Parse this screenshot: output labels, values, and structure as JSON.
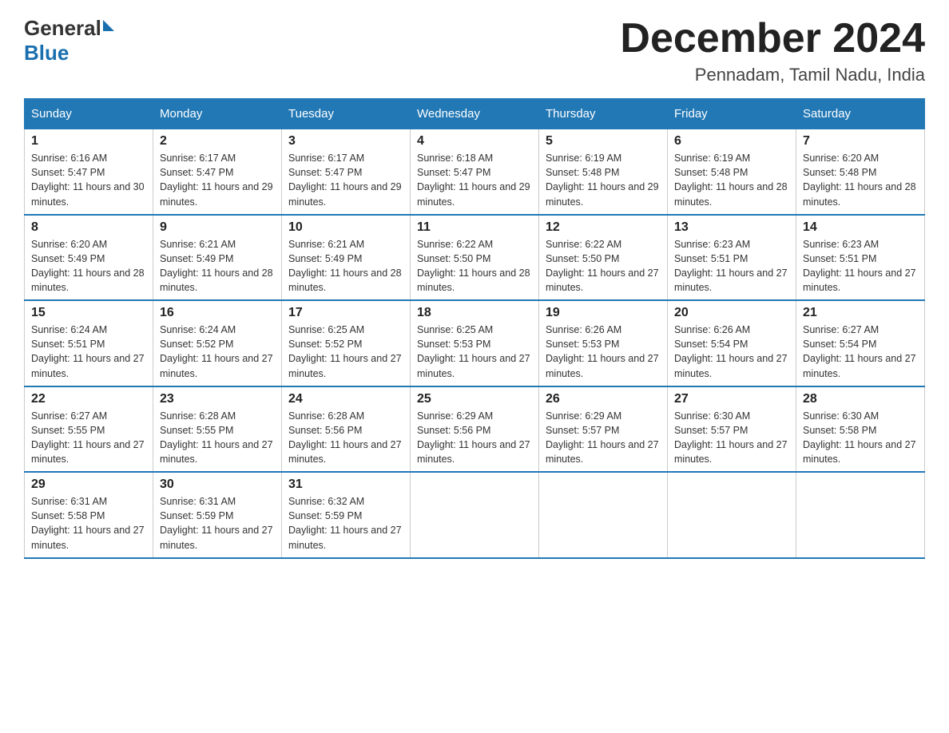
{
  "header": {
    "logo_general": "General",
    "logo_blue": "Blue",
    "month_title": "December 2024",
    "location": "Pennadam, Tamil Nadu, India"
  },
  "weekdays": [
    "Sunday",
    "Monday",
    "Tuesday",
    "Wednesday",
    "Thursday",
    "Friday",
    "Saturday"
  ],
  "weeks": [
    [
      {
        "day": "1",
        "sunrise": "6:16 AM",
        "sunset": "5:47 PM",
        "daylight": "11 hours and 30 minutes."
      },
      {
        "day": "2",
        "sunrise": "6:17 AM",
        "sunset": "5:47 PM",
        "daylight": "11 hours and 29 minutes."
      },
      {
        "day": "3",
        "sunrise": "6:17 AM",
        "sunset": "5:47 PM",
        "daylight": "11 hours and 29 minutes."
      },
      {
        "day": "4",
        "sunrise": "6:18 AM",
        "sunset": "5:47 PM",
        "daylight": "11 hours and 29 minutes."
      },
      {
        "day": "5",
        "sunrise": "6:19 AM",
        "sunset": "5:48 PM",
        "daylight": "11 hours and 29 minutes."
      },
      {
        "day": "6",
        "sunrise": "6:19 AM",
        "sunset": "5:48 PM",
        "daylight": "11 hours and 28 minutes."
      },
      {
        "day": "7",
        "sunrise": "6:20 AM",
        "sunset": "5:48 PM",
        "daylight": "11 hours and 28 minutes."
      }
    ],
    [
      {
        "day": "8",
        "sunrise": "6:20 AM",
        "sunset": "5:49 PM",
        "daylight": "11 hours and 28 minutes."
      },
      {
        "day": "9",
        "sunrise": "6:21 AM",
        "sunset": "5:49 PM",
        "daylight": "11 hours and 28 minutes."
      },
      {
        "day": "10",
        "sunrise": "6:21 AM",
        "sunset": "5:49 PM",
        "daylight": "11 hours and 28 minutes."
      },
      {
        "day": "11",
        "sunrise": "6:22 AM",
        "sunset": "5:50 PM",
        "daylight": "11 hours and 28 minutes."
      },
      {
        "day": "12",
        "sunrise": "6:22 AM",
        "sunset": "5:50 PM",
        "daylight": "11 hours and 27 minutes."
      },
      {
        "day": "13",
        "sunrise": "6:23 AM",
        "sunset": "5:51 PM",
        "daylight": "11 hours and 27 minutes."
      },
      {
        "day": "14",
        "sunrise": "6:23 AM",
        "sunset": "5:51 PM",
        "daylight": "11 hours and 27 minutes."
      }
    ],
    [
      {
        "day": "15",
        "sunrise": "6:24 AM",
        "sunset": "5:51 PM",
        "daylight": "11 hours and 27 minutes."
      },
      {
        "day": "16",
        "sunrise": "6:24 AM",
        "sunset": "5:52 PM",
        "daylight": "11 hours and 27 minutes."
      },
      {
        "day": "17",
        "sunrise": "6:25 AM",
        "sunset": "5:52 PM",
        "daylight": "11 hours and 27 minutes."
      },
      {
        "day": "18",
        "sunrise": "6:25 AM",
        "sunset": "5:53 PM",
        "daylight": "11 hours and 27 minutes."
      },
      {
        "day": "19",
        "sunrise": "6:26 AM",
        "sunset": "5:53 PM",
        "daylight": "11 hours and 27 minutes."
      },
      {
        "day": "20",
        "sunrise": "6:26 AM",
        "sunset": "5:54 PM",
        "daylight": "11 hours and 27 minutes."
      },
      {
        "day": "21",
        "sunrise": "6:27 AM",
        "sunset": "5:54 PM",
        "daylight": "11 hours and 27 minutes."
      }
    ],
    [
      {
        "day": "22",
        "sunrise": "6:27 AM",
        "sunset": "5:55 PM",
        "daylight": "11 hours and 27 minutes."
      },
      {
        "day": "23",
        "sunrise": "6:28 AM",
        "sunset": "5:55 PM",
        "daylight": "11 hours and 27 minutes."
      },
      {
        "day": "24",
        "sunrise": "6:28 AM",
        "sunset": "5:56 PM",
        "daylight": "11 hours and 27 minutes."
      },
      {
        "day": "25",
        "sunrise": "6:29 AM",
        "sunset": "5:56 PM",
        "daylight": "11 hours and 27 minutes."
      },
      {
        "day": "26",
        "sunrise": "6:29 AM",
        "sunset": "5:57 PM",
        "daylight": "11 hours and 27 minutes."
      },
      {
        "day": "27",
        "sunrise": "6:30 AM",
        "sunset": "5:57 PM",
        "daylight": "11 hours and 27 minutes."
      },
      {
        "day": "28",
        "sunrise": "6:30 AM",
        "sunset": "5:58 PM",
        "daylight": "11 hours and 27 minutes."
      }
    ],
    [
      {
        "day": "29",
        "sunrise": "6:31 AM",
        "sunset": "5:58 PM",
        "daylight": "11 hours and 27 minutes."
      },
      {
        "day": "30",
        "sunrise": "6:31 AM",
        "sunset": "5:59 PM",
        "daylight": "11 hours and 27 minutes."
      },
      {
        "day": "31",
        "sunrise": "6:32 AM",
        "sunset": "5:59 PM",
        "daylight": "11 hours and 27 minutes."
      },
      null,
      null,
      null,
      null
    ]
  ]
}
